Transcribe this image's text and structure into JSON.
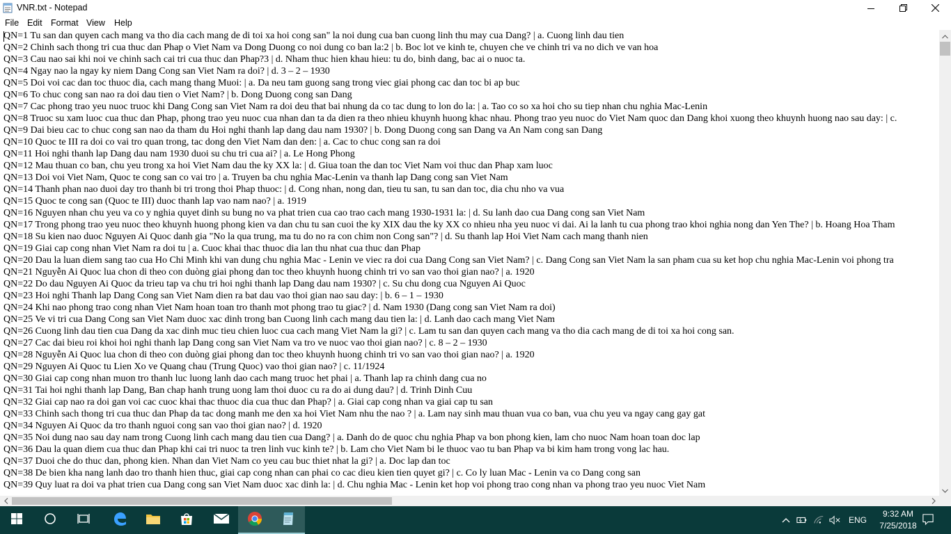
{
  "window": {
    "title": "VNR.txt - Notepad",
    "icons": [
      "notepad-icon",
      "minimize-icon",
      "maximize-icon",
      "close-icon"
    ]
  },
  "menu": {
    "items": [
      "File",
      "Edit",
      "Format",
      "View",
      "Help"
    ]
  },
  "editor": {
    "lines": [
      "QN=1 Tu san dan quyen cach mang va tho dia cach mang de di toi xa hoi cong san\" la noi dung cua ban cuong linh thu may cua Dang? | a. Cuong linh dau tien",
      "QN=2 Chinh sach thong tri cua thuc dan Phap o Viet Nam va Dong Duong co noi dung co ban la:2 | b. Boc lot ve kinh te, chuyen che ve chinh tri va no dich ve van hoa",
      "QN=3 Cau nao sai khi noi ve chinh sach cai tri cua thuc dan Phap?3 | d. Nham thuc hien khau hieu: tu do, binh dang, bac ai o nuoc ta.",
      "QN=4 Ngay nao la ngay ky niem Dang Cong san Viet Nam ra doi? | d. 3 – 2 – 1930",
      "QN=5 Doi voi cac dan toc thuoc dia, cach mang thang Muoi: | a. Da neu tam guong sang trong viec giai phong cac dan toc bi ap buc",
      "QN=6 To chuc cong san nao ra doi dau tien o Viet Nam? | b. Dong Duong cong san Dang",
      "QN=7 Cac phong trao yeu nuoc truoc khi Dang Cong san Viet Nam ra doi deu that bai nhung da co tac dung to lon do la: | a. Tao co so xa hoi cho su tiep nhan chu nghia Mac-Lenin",
      "QN=8 Truoc su xam luoc cua thuc dan Phap, phong trao yeu nuoc cua nhan dan ta da dien ra theo nhieu khuynh huong khac nhau. Phong trao yeu nuoc do Viet Nam quoc dan Dang khoi xuong theo khuynh huong nao sau day: | c. ",
      "QN=9 Dai bieu cac to chuc cong san nao da tham du Hoi nghi thanh lap dang dau nam 1930? | b. Dong Duong cong san Dang va An Nam cong san Dang",
      "QN=10 Quoc te III ra doi co vai tro quan trong, tac dong den Viet Nam dan den: | a. Cac to chuc cong san ra doi",
      "QN=11 Hoi nghi thanh lap Dang dau nam 1930 duoi su chu tri cua ai? | a. Le Hong Phong",
      "QN=12 Mau thuan co ban, chu yeu trong xa hoi Viet Nam dau the ky XX la: | d. Giua toan the dan toc Viet Nam voi thuc dan Phap xam luoc",
      "QN=13 Doi voi Viet Nam, Quoc te cong san co vai tro | a. Truyen ba chu nghia Mac-Lenin va thanh lap Dang cong san Viet Nam",
      "QN=14 Thanh phan nao duoi day tro thanh bi tri trong thoi Phap thuoc: | d. Cong nhan, nong dan, tieu tu san, tu san dan toc, dia chu nho va vua",
      "QN=15 Quoc te cong san (Quoc te III) duoc thanh lap vao nam nao? | a. 1919",
      "QN=16 Nguyen nhan chu yeu va co y nghia quyet dinh su bung no va phat trien cua cao trao cach mang 1930-1931 la: | d. Su lanh dao cua Dang cong san Viet Nam",
      "QN=17 Trong phong trao yeu nuoc theo khuynh huong phong kien va dan chu tu san cuoi the ky XIX dau the ky XX co nhieu nha yeu nuoc vi dai. Ai la lanh tu cua phong trao khoi nghia nong dan Yen The? | b. Hoang Hoa Tham",
      "QN=18 Su kien nao duoc Nguyen Ai Quoc danh gia \"No la qua trung, ma tu do no ra con chim non Cong san\"? | d. Su thanh lap Hoi Viet Nam cach mang thanh nien",
      "QN=19 Giai cap cong nhan Viet Nam ra doi tu | a. Cuoc khai thac thuoc dia lan thu nhat cua thuc dan Phap",
      "QN=20 Dau la luan diem sang tao cua Ho Chi Minh khi van dung chu nghia Mac - Lenin ve viec ra doi cua Dang Cong san Viet Nam? | c. Dang Cong san Viet Nam la san pham cua su ket hop chu nghia Mac-Lenin voi phong tra",
      "QN=21 Nguyễn Ai Quoc lua chon di theo con duòng giai phong dan toc theo khuynh huong chinh tri vo san vao thoi gian nao? | a. 1920",
      "QN=22 Do dau Nguyen Ai Quoc da trieu tap va chu tri hoi nghi thanh lap Dang dau nam 1930? | c. Su chu dong cua Nguyen Ai Quoc",
      "QN=23 Hoi nghi Thanh lap Dang Cong san Viet Nam dien ra bat dau vao thoi gian nao sau day: | b. 6 – 1 – 1930",
      "QN=24 Khi nao phong trao cong nhan Viet Nam hoan toan tro thanh mot phong trao tu giac? | d. Nam 1930 (Dang cong san Viet Nam ra doi)",
      "QN=25 Ve vi tri cua Dang Cong san Viet Nam duoc xac dinh trong ban Cuong linh cach mang dau tien la: | d. Lanh dao cach mang Viet Nam",
      "QN=26 Cuong linh dau tien cua Dang da xac dinh muc tieu chien luoc cua cach mang Viet Nam la gi? | c. Lam tu san dan quyen cach mang va tho dia cach mang de di toi xa hoi cong san.",
      "QN=27 Cac dai bieu roi khoi hoi nghi thanh lap Dang cong san Viet Nam va tro ve nuoc vao thoi gian nao? | c. 8 – 2 – 1930",
      "QN=28 Nguyễn Ai Quoc lua chon di theo con duòng giai phong dan toc theo khuynh huong chinh tri vo san vao thoi gian nao? | a. 1920",
      "QN=29 Nguyen Ai Quoc tu Lien Xo ve Quang chau (Trung Quoc) vao thoi gian nao? | c. 11/1924",
      "QN=30 Giai cap cong nhan muon tro thanh luc luong lanh dao cach mang truoc het phai | a. Thanh lap ra chinh dang cua no",
      "QN=31 Tai hoi nghi thanh lap Dang, Ban chap hanh trung uong lam thoi duoc cu ra do ai dung dau? | d. Trinh Dinh Cuu",
      "QN=32 Giai cap nao ra doi gan voi cac cuoc khai thac thuoc dia cua thuc dan Phap? | a. Giai cap cong nhan va giai cap tu san",
      "QN=33 Chinh sach thong tri cua thuc dan Phap da tac dong manh me den xa hoi Viet Nam nhu the nao ? | a. Lam nay sinh mau thuan vua co ban, vua chu yeu va ngay cang gay gat",
      "QN=34 Nguyen Ai Quoc da tro thanh nguoi cong san vao thoi gian nao? | d. 1920",
      "QN=35 Noi dung nao sau day nam trong Cuong linh cach mang dau tien cua Dang? | a. Danh do de quoc chu nghia Phap va bon phong kien, lam cho nuoc Nam hoan toan doc lap",
      "QN=36 Dau la quan diem cua thuc dan Phap khi cai tri nuoc ta tren linh vuc kinh te? | b. Lam cho Viet Nam bi le thuoc vao tu ban Phap va bi kim ham trong vong lac hau.",
      "QN=37 Duoi che do thuc dan, phong kien. Nhan dan Viet Nam co yeu cau buc thiet nhat la gi? | a. Doc lap dan toc",
      "QN=38 De bien kha nang lanh dao tro thanh hien thuc, giai cap cong nhan can phai co cac dieu kien tien quyet gi? | c. Co ly luan Mac - Lenin va co Dang cong san",
      "QN=39 Quy luat ra doi va phat trien cua Dang cong san Viet Nam duoc xac dinh la: | d. Chu nghia Mac - Lenin ket hop voi phong trao cong nhan va phong trao yeu nuoc Viet Nam"
    ]
  },
  "taskbar": {
    "icons": [
      "start-icon",
      "search-icon",
      "task-view-icon",
      "edge-icon",
      "file-explorer-icon",
      "store-icon",
      "mail-icon",
      "chrome-icon",
      "notepad-icon"
    ],
    "tray_icons": [
      "chevron-up-icon",
      "battery-icon",
      "wifi-icon",
      "volume-icon",
      "notification-icon"
    ],
    "language": "ENG",
    "time": "9:32 AM",
    "date": "7/25/2018"
  },
  "colors": {
    "taskbar": "#0a3a3a",
    "taskbar_active": "#2e5a5a",
    "scrollbar_thumb": "#c1c1c1"
  }
}
